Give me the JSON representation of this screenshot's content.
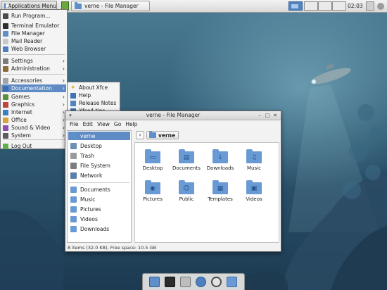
{
  "top_panel": {
    "apps_menu_label": "Applications Menu",
    "window_task_label": "verne - File Manager",
    "clock": "02:03"
  },
  "apps_menu": {
    "items": [
      {
        "label": "Run Program...",
        "icon": "run-icon",
        "submenu": false
      },
      {
        "label": "Terminal Emulator",
        "icon": "terminal-icon",
        "submenu": false
      },
      {
        "label": "File Manager",
        "icon": "file-manager-icon",
        "submenu": false
      },
      {
        "label": "Mail Reader",
        "icon": "mail-icon",
        "submenu": false
      },
      {
        "label": "Web Browser",
        "icon": "web-browser-icon",
        "submenu": false
      },
      {
        "label": "Settings",
        "icon": "settings-icon",
        "submenu": true
      },
      {
        "label": "Administration",
        "icon": "administration-icon",
        "submenu": true
      },
      {
        "label": "Accessories",
        "icon": "accessories-icon",
        "submenu": true
      },
      {
        "label": "Documentation",
        "icon": "documentation-icon",
        "submenu": true,
        "selected": true
      },
      {
        "label": "Games",
        "icon": "games-icon",
        "submenu": true
      },
      {
        "label": "Graphics",
        "icon": "graphics-icon",
        "submenu": true
      },
      {
        "label": "Internet",
        "icon": "internet-icon",
        "submenu": true
      },
      {
        "label": "Office",
        "icon": "office-icon",
        "submenu": true
      },
      {
        "label": "Sound & Video",
        "icon": "sound-video-icon",
        "submenu": true
      },
      {
        "label": "System",
        "icon": "system-icon",
        "submenu": true
      },
      {
        "label": "Log Out",
        "icon": "log-out-icon",
        "submenu": false
      }
    ]
  },
  "documentation_submenu": {
    "items": [
      {
        "label": "About Xfce",
        "icon": "star-icon"
      },
      {
        "label": "Help",
        "icon": "help-icon"
      },
      {
        "label": "Release Notes",
        "icon": "release-notes-icon"
      },
      {
        "label": "Xfce4 tips",
        "icon": "tips-icon"
      }
    ]
  },
  "file_manager": {
    "title": "verne - File Manager",
    "menubar": [
      "File",
      "Edit",
      "View",
      "Go",
      "Help"
    ],
    "sidebar_devices": [
      {
        "label": "verne",
        "icon": "home-folder-icon",
        "selected": true
      },
      {
        "label": "Desktop",
        "icon": "desktop-icon"
      },
      {
        "label": "Trash",
        "icon": "trash-icon"
      },
      {
        "label": "File System",
        "icon": "drive-icon"
      },
      {
        "label": "Network",
        "icon": "network-icon"
      }
    ],
    "sidebar_places": [
      {
        "label": "Documents",
        "icon": "folder-icon"
      },
      {
        "label": "Music",
        "icon": "folder-icon"
      },
      {
        "label": "Pictures",
        "icon": "folder-icon"
      },
      {
        "label": "Videos",
        "icon": "folder-icon"
      },
      {
        "label": "Downloads",
        "icon": "folder-icon"
      }
    ],
    "location": "verne",
    "files": [
      {
        "label": "Desktop",
        "glyph": "▭"
      },
      {
        "label": "Documents",
        "glyph": "▤"
      },
      {
        "label": "Downloads",
        "glyph": "↓"
      },
      {
        "label": "Music",
        "glyph": "♫"
      },
      {
        "label": "Pictures",
        "glyph": "◉"
      },
      {
        "label": "Public",
        "glyph": "☺"
      },
      {
        "label": "Templates",
        "glyph": "▦"
      },
      {
        "label": "Videos",
        "glyph": "▣"
      }
    ],
    "status": "8 items (32.0 KB), Free space: 10.5 GB"
  },
  "dock": {
    "items": [
      "show-desktop-icon",
      "terminal-icon",
      "file-manager-icon",
      "web-browser-icon",
      "search-icon",
      "folder-icon"
    ]
  },
  "colors": {
    "selection": "#5f8bc4",
    "folder": "#6a9ad3",
    "panel": "#dcdcdc"
  }
}
